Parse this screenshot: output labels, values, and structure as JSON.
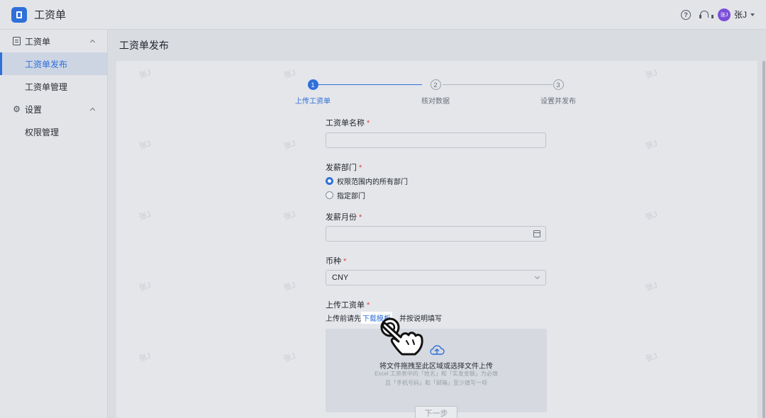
{
  "app": {
    "title": "工资单"
  },
  "header": {
    "help_icon": "question-circle-icon",
    "support_icon": "headset-icon",
    "avatar_text": "张J",
    "username": "张J"
  },
  "sidebar": {
    "groups": [
      {
        "label": "工资单",
        "icon": "document-icon",
        "items": [
          {
            "label": "工资单发布",
            "active": true
          },
          {
            "label": "工资单管理",
            "active": false
          }
        ]
      },
      {
        "label": "设置",
        "icon": "gear-icon",
        "items": [
          {
            "label": "权限管理",
            "active": false
          }
        ]
      }
    ]
  },
  "page": {
    "title": "工资单发布"
  },
  "steps": [
    {
      "num": "1",
      "label": "上传工资单",
      "active": true
    },
    {
      "num": "2",
      "label": "核对数据",
      "active": false
    },
    {
      "num": "3",
      "label": "设置并发布",
      "active": false
    }
  ],
  "form": {
    "name_label": "工资单名称",
    "name_value": "",
    "dept_label": "发薪部门",
    "dept_options": [
      {
        "label": "权限范围内的所有部门",
        "checked": true
      },
      {
        "label": "指定部门",
        "checked": false
      }
    ],
    "month_label": "发薪月份",
    "month_value": "",
    "currency_label": "币种",
    "currency_value": "CNY",
    "upload_label": "上传工资单",
    "hint_prefix": "上传前请先",
    "hint_link": "下载模板",
    "hint_suffix": "，并按说明填写",
    "required_mark": "*"
  },
  "upload": {
    "title": "将文件拖拽至此区域或选择文件上传",
    "line1": "Excel 工资表中的「姓名」和「实发金额」为必填",
    "line2": "且「手机号码」和「邮箱」至少填写一项"
  },
  "footer": {
    "next_label": "下一步"
  },
  "watermark": "张J",
  "colors": {
    "accent": "#2f6fd9",
    "required": "#e04040",
    "avatar": "#7b4fd8"
  }
}
